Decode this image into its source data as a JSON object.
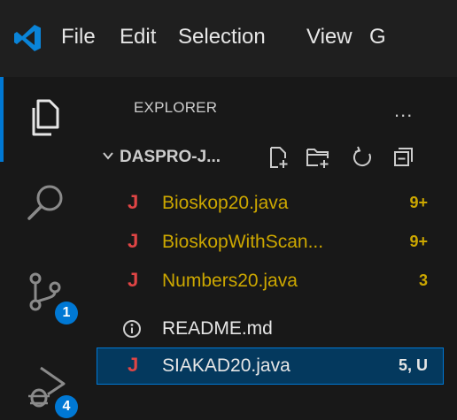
{
  "menu": {
    "items": [
      "File",
      "Edit",
      "Selection",
      "View",
      "G"
    ]
  },
  "activity_bar": {
    "icons": [
      "explorer-icon",
      "search-icon",
      "source-control-icon",
      "run-debug-icon"
    ],
    "source_control_badge": "1",
    "debug_badge": "4"
  },
  "explorer": {
    "title": "EXPLORER",
    "more_label": "...",
    "folder_name": "DASPRO-J...",
    "files": [
      {
        "name": "Bioskop20.java",
        "badge": "9+",
        "icon": "java-icon",
        "color": "#cca700"
      },
      {
        "name": "BioskopWithScan...",
        "badge": "9+",
        "icon": "java-icon",
        "color": "#cca700"
      },
      {
        "name": "Numbers20.java",
        "badge": "3",
        "icon": "java-icon",
        "color": "#cca700"
      },
      {
        "name": "README.md",
        "badge": "",
        "icon": "info-icon",
        "color": "#e6e6e6"
      },
      {
        "name": "SIAKAD20.java",
        "badge": "5, U",
        "icon": "java-icon",
        "color": "#e6e6e6",
        "selected": true
      }
    ]
  },
  "colors": {
    "accent": "#0078d4",
    "warning": "#cca700",
    "java_icon": "#e04545",
    "selection_bg": "#04395e"
  }
}
